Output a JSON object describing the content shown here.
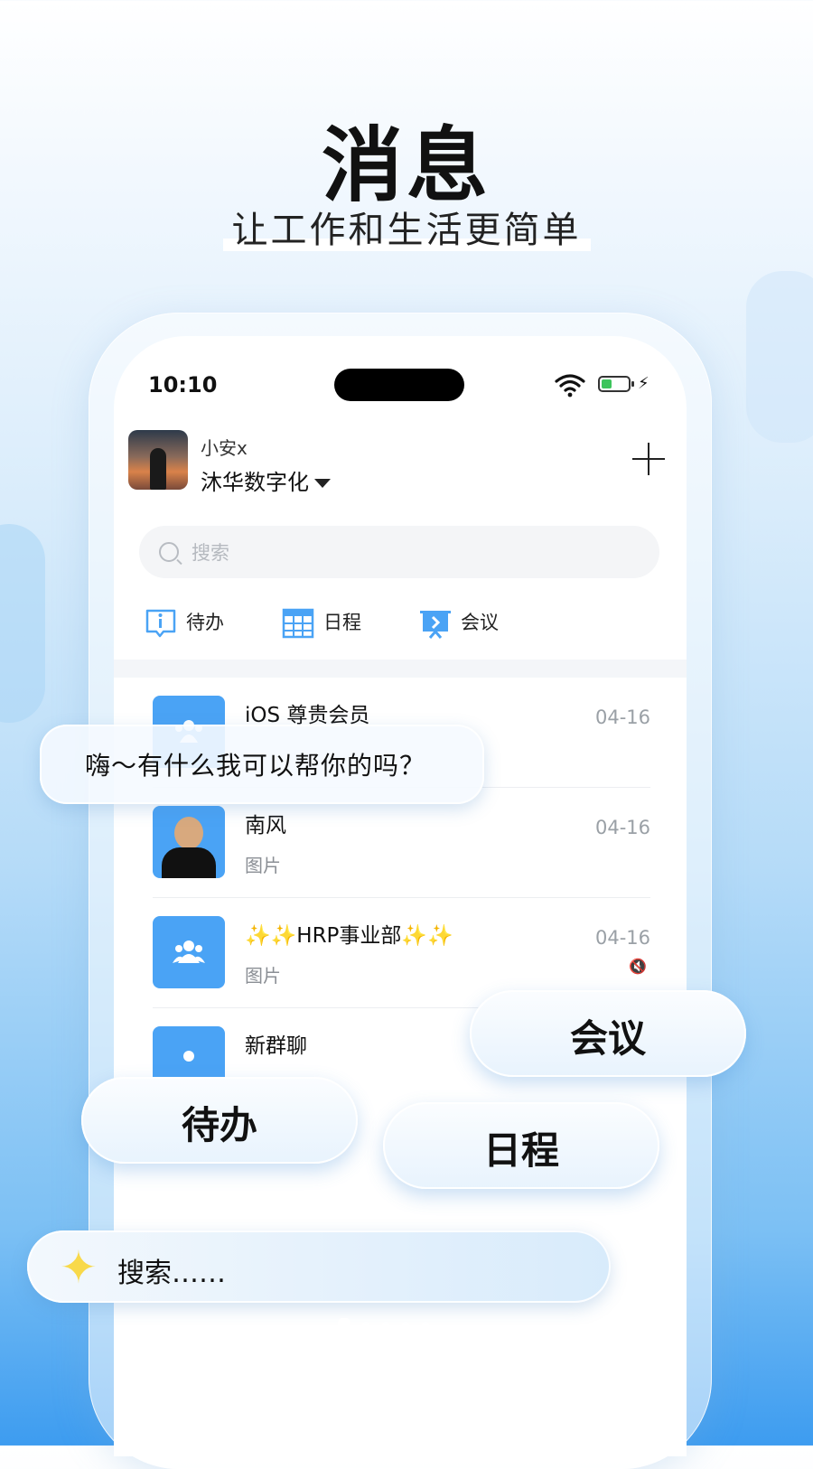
{
  "hero": {
    "title": "消息",
    "subtitle": "让工作和生活更简单"
  },
  "status_bar": {
    "time": "10:10"
  },
  "header": {
    "user_name": "小安x",
    "org_name": "沐华数字化"
  },
  "search": {
    "placeholder": "搜索"
  },
  "quick_actions": [
    {
      "label": "待办",
      "icon": "todo-icon"
    },
    {
      "label": "日程",
      "icon": "calendar-icon"
    },
    {
      "label": "会议",
      "icon": "meeting-icon"
    }
  ],
  "chats": [
    {
      "name": "iOS 尊贵会员",
      "preview": "",
      "time": "04-16",
      "avatar": "group-icon"
    },
    {
      "name": "南风",
      "preview": "图片",
      "time": "04-16",
      "avatar": "person-photo"
    },
    {
      "name": "✨✨HRP事业部✨✨",
      "preview": "图片",
      "time": "04-16",
      "avatar": "group-icon",
      "muted": true
    },
    {
      "name": "新群聊",
      "preview": "",
      "time": "",
      "avatar": "group-icon"
    }
  ],
  "overlays": {
    "chat_bubble": "嗨～有什么我可以帮你的吗？",
    "meeting": "会议",
    "todo": "待办",
    "schedule": "日程",
    "search": "搜索……"
  },
  "colors": {
    "accent": "#4aa3f5",
    "battery": "#3dc45c",
    "spark": "#f8d94a"
  }
}
